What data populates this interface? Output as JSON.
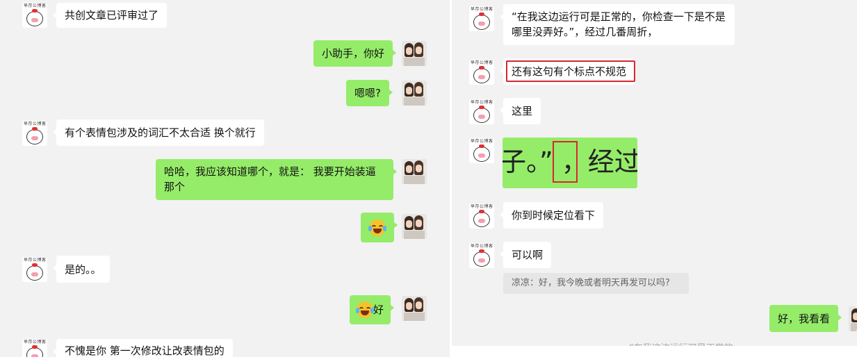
{
  "left_chat": {
    "messages": [
      {
        "sender": "other",
        "text": "共创文章已评审过了"
      },
      {
        "sender": "me",
        "text": "小助手，你好"
      },
      {
        "sender": "me",
        "text": "嗯嗯?"
      },
      {
        "sender": "other",
        "text": "有个表情包涉及的词汇不太合适 换个就行"
      },
      {
        "sender": "me",
        "text": "哈哈，我应该知道哪个，就是： 我要开始装逼那个"
      },
      {
        "sender": "me",
        "emoji": "laughing-tears"
      },
      {
        "sender": "other",
        "text": "是的。。"
      },
      {
        "sender": "me",
        "emoji": "laughing-tears",
        "text": "好"
      },
      {
        "sender": "other",
        "text": "不愧是你 第一次修改让改表情包的"
      }
    ]
  },
  "right_chat": {
    "messages": [
      {
        "sender": "other",
        "text": "“在我这边运行可是正常的，你检查一下是不是哪里没弄好。”，经过几番周折，"
      },
      {
        "sender": "other",
        "text": "还有这句有个标点不规范",
        "highlight": "red-box"
      },
      {
        "sender": "other",
        "text": "这里"
      },
      {
        "sender": "other",
        "image_text": "子。” ，经过",
        "highlight": "red-box-around-comma"
      },
      {
        "sender": "other",
        "text": "你到时候定位看下"
      },
      {
        "sender": "other",
        "text": "可以啊"
      },
      {
        "sender": "quote",
        "text": "凉凉：好，我今晚或者明天再发可以吗?"
      },
      {
        "sender": "me",
        "text": "好，我看看"
      }
    ],
    "cutoff_text": "“在我这边运行可是正常的"
  },
  "colors": {
    "me_bubble": "#95ec69",
    "other_bubble": "#ffffff",
    "panel_bg": "#f2f2f2",
    "highlight": "#d8262e"
  },
  "avatars": {
    "other": "bear-brand-avatar",
    "me": "couple-photo-avatar"
  }
}
